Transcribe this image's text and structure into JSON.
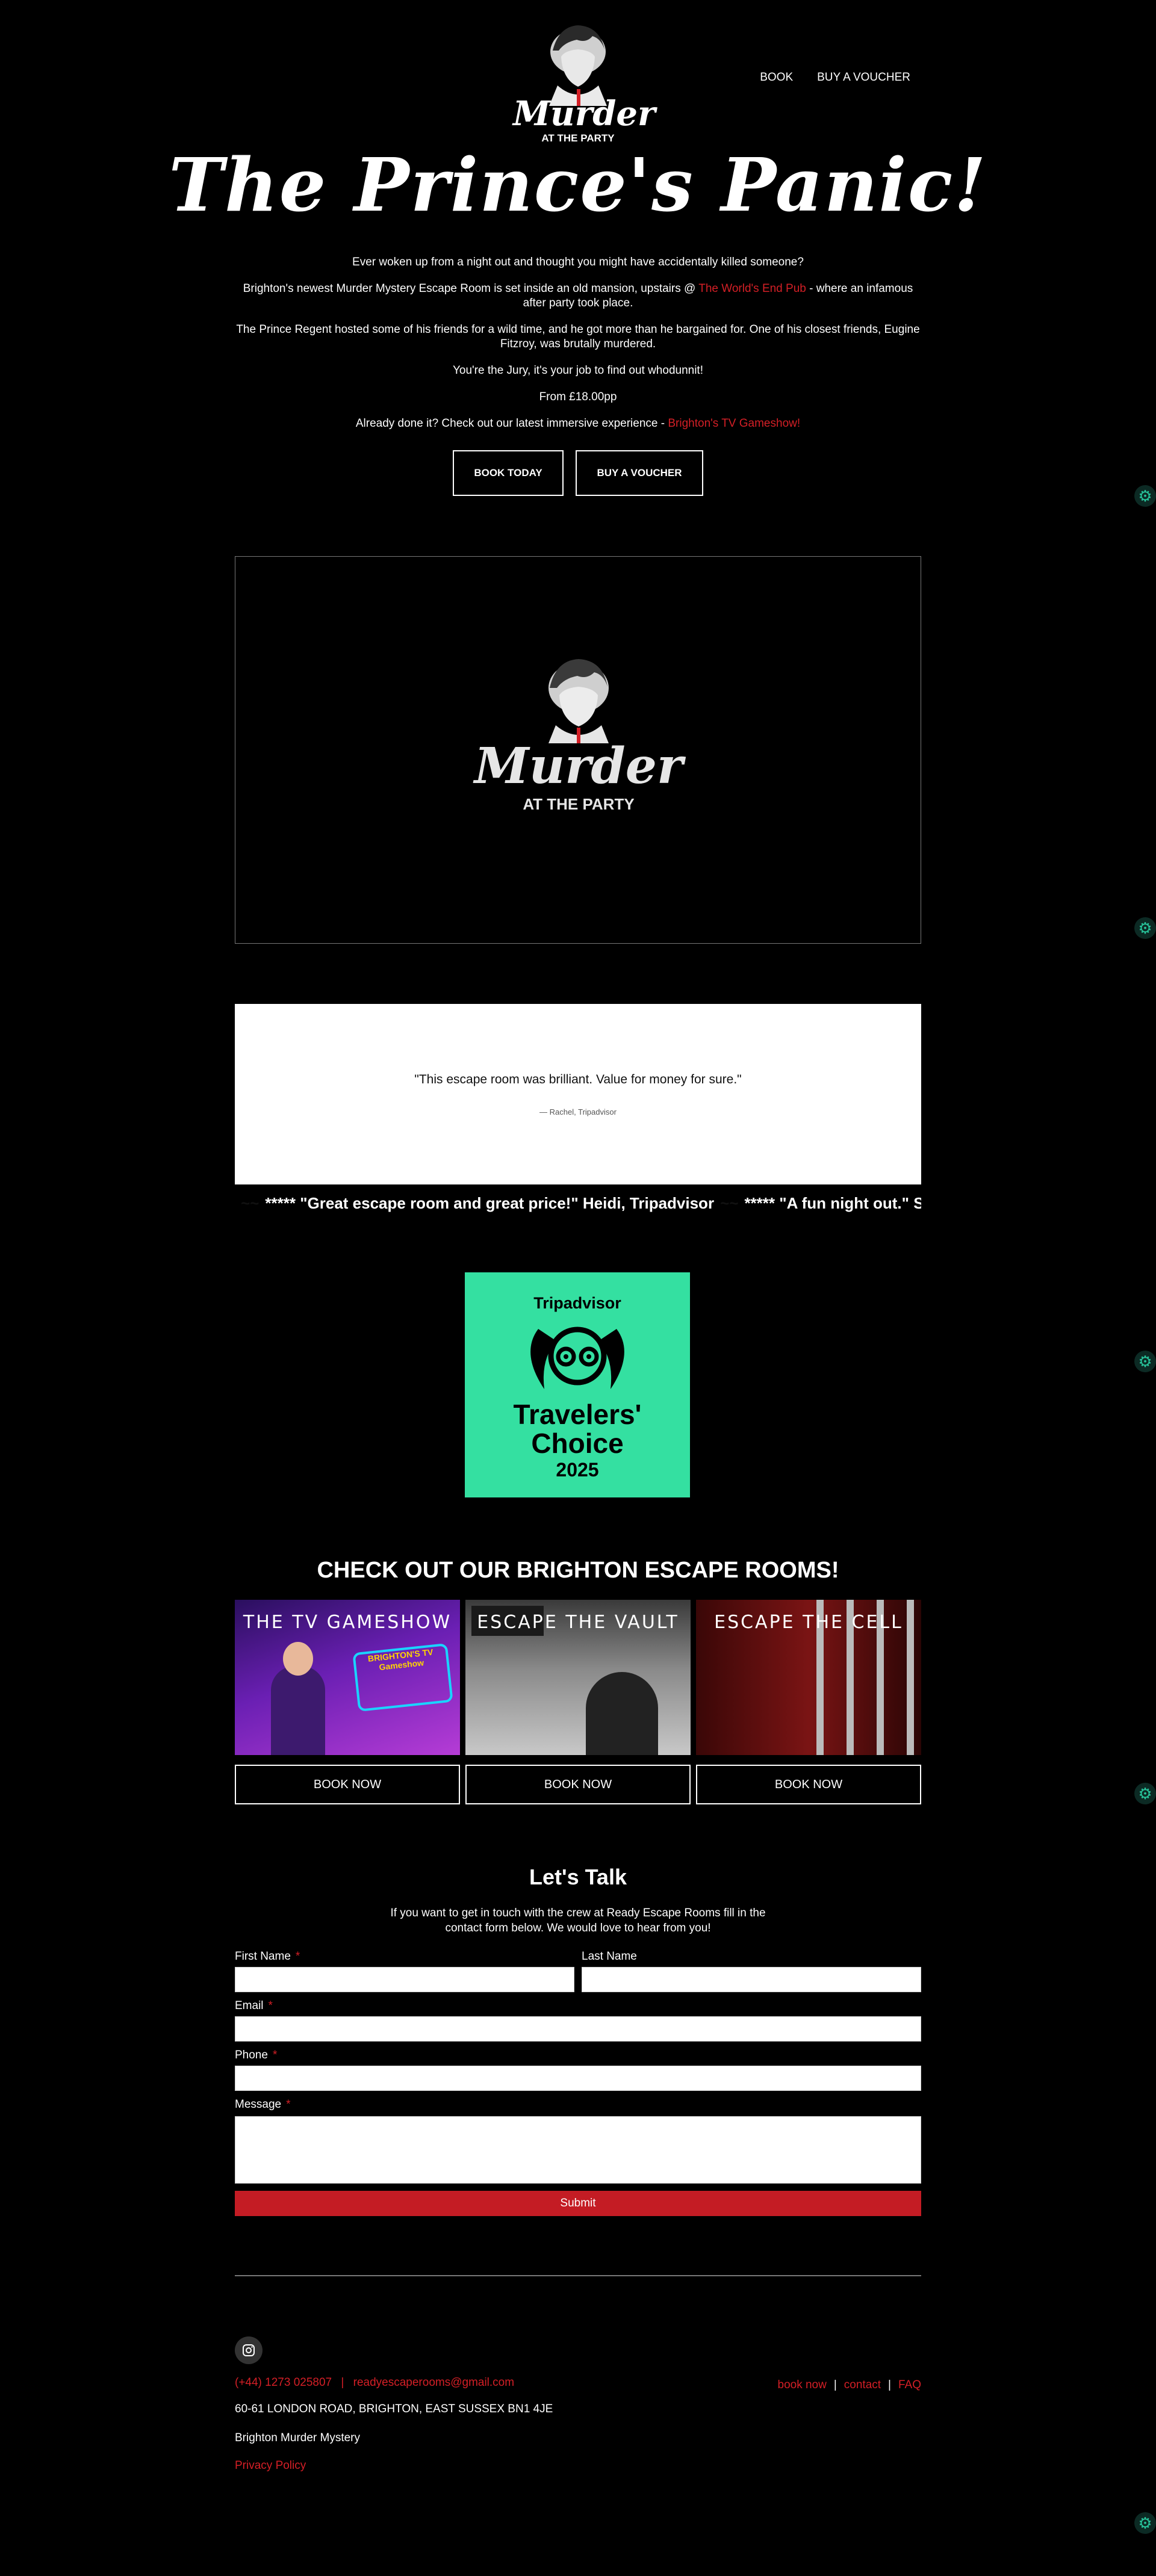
{
  "header": {
    "logo_script": "Murder",
    "logo_sub": "AT THE PARTY",
    "nav": [
      "BOOK",
      "BUY A VOUCHER"
    ]
  },
  "hero": {
    "title": "The Prince's Panic!",
    "p1": "Ever woken up from a night out and thought you might have accidentally killed someone?",
    "p2_before": "Brighton's newest Murder Mystery Escape Room is set inside an old mansion, upstairs @ ",
    "p2_link": "The World's End Pub",
    "p2_after": " - where an infamous after party took place.",
    "p3": "The Prince Regent hosted some of his friends for a wild time, and he got more than he bargained for. One of his closest friends, Eugine Fitzroy, was brutally murdered.",
    "p4": "You're the Jury, it's your job to find out whodunnit!",
    "p5": "From £18.00pp",
    "p6_before": "Already done it? Check out our latest immersive experience - ",
    "p6_link": "Brighton's TV Gameshow!",
    "btn_book": "BOOK TODAY",
    "btn_voucher": "BUY A VOUCHER"
  },
  "video": {
    "logo_script": "Murder",
    "logo_sub": "AT THE PARTY"
  },
  "testimonial": {
    "quote": "\"This escape room was brilliant. Value for money for sure.\"",
    "attribution": "— Rachel, Tripadvisor"
  },
  "ticker": {
    "item1": "***** \"Great escape room and great price!\" Heidi, Tripadvisor",
    "item2": "***** \"A fun night out.\" Simon, Tr"
  },
  "badge": {
    "brand": "Tripadvisor",
    "line1": "Travelers'",
    "line2": "Choice",
    "year": "2025",
    "color": "#34e0a1"
  },
  "rooms": {
    "heading": "CHECK OUT OUR BRIGHTON ESCAPE ROOMS!",
    "items": [
      {
        "label": "THE TV GAMESHOW",
        "button": "BOOK NOW",
        "poster": "BRIGHTON'S TV Gameshow"
      },
      {
        "label": "ESCAPE THE VAULT",
        "button": "BOOK NOW"
      },
      {
        "label": "ESCAPE THE CELL",
        "button": "BOOK NOW"
      }
    ]
  },
  "contact": {
    "heading": "Let's Talk",
    "intro": "If you want to get in touch with the crew at Ready Escape Rooms fill in the contact form below. We would love to hear from you!",
    "first_name": "First Name",
    "last_name": "Last Name",
    "email": "Email",
    "phone": "Phone",
    "message": "Message",
    "required": "*",
    "submit": "Submit"
  },
  "footer": {
    "phone": "(+44) 1273 025807",
    "sep": "|",
    "email": "readyescaperooms@gmail.com",
    "address": "60-61 LONDON ROAD, BRIGHTON, EAST SUSSEX BN1 4JE",
    "tagline": "Brighton Murder Mystery",
    "privacy": "Privacy Policy",
    "links": [
      "book now",
      "contact",
      "FAQ"
    ]
  },
  "colors": {
    "accent": "#d41f26",
    "background": "#000000",
    "widget": "#27c29a"
  }
}
